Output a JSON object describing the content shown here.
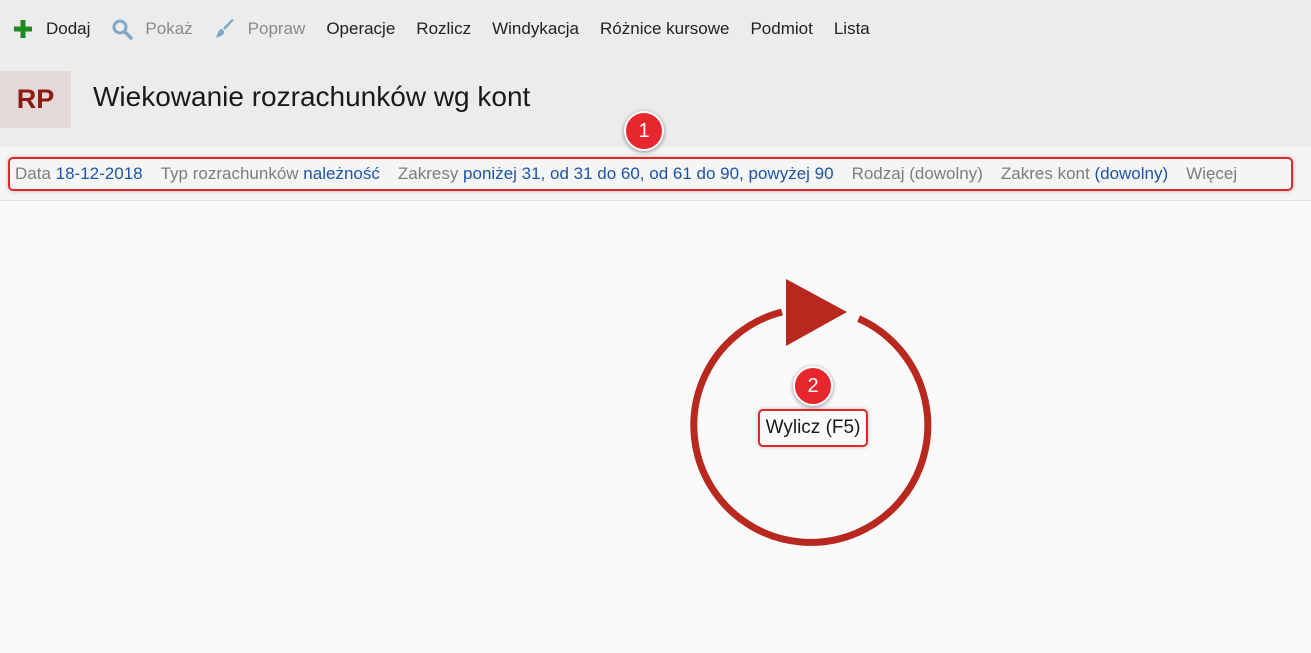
{
  "toolbar": {
    "items": [
      {
        "label": "Dodaj",
        "icon": "plus-icon",
        "enabled": true
      },
      {
        "label": "Pokaż",
        "icon": "magnifier-icon",
        "enabled": false
      },
      {
        "label": "Popraw",
        "icon": "brush-icon",
        "enabled": false
      },
      {
        "label": "Operacje",
        "enabled": true
      },
      {
        "label": "Rozlicz",
        "enabled": true
      },
      {
        "label": "Windykacja",
        "enabled": true
      },
      {
        "label": "Różnice kursowe",
        "enabled": true
      },
      {
        "label": "Podmiot",
        "enabled": true
      },
      {
        "label": "Lista",
        "enabled": true
      }
    ]
  },
  "header": {
    "badge": "RP",
    "title": "Wiekowanie rozrachunków wg kont"
  },
  "filters": {
    "date_label": "Data",
    "date_value": "18-12-2018",
    "type_label": "Typ rozrachunków",
    "type_value": "należność",
    "ranges_label": "Zakresy",
    "ranges_value": "poniżej 31, od 31 do 60, od 61 do 90, powyżej 90",
    "kind_label": "Rodzaj (dowolny)",
    "accounts_label": "Zakres kont",
    "accounts_value": "(dowolny)",
    "more_label": "Więcej"
  },
  "markers": {
    "one": "1",
    "two": "2"
  },
  "compute_button": {
    "label": "Wylicz (F5)"
  },
  "colors": {
    "accent_red": "#e2262c",
    "refresh_red": "#b8281e",
    "link_blue": "#1d55a8",
    "badge_text": "#8b1a10",
    "add_green": "#1f8a1f"
  }
}
